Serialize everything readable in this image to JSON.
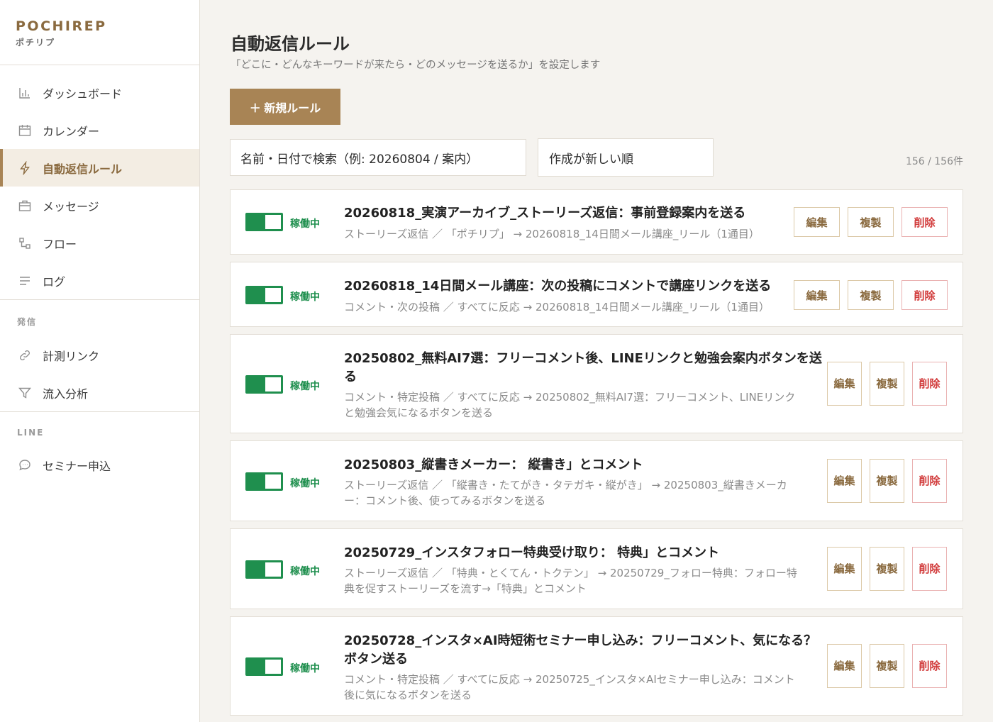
{
  "brand": {
    "name": "POCHIREP",
    "sub": "ポチリプ"
  },
  "sidebar": {
    "items": [
      {
        "label": "ダッシュボード",
        "icon": "bar-chart-icon"
      },
      {
        "label": "カレンダー",
        "icon": "calendar-icon"
      },
      {
        "label": "自動返信ルール",
        "icon": "lightning-icon",
        "active": true
      },
      {
        "label": "メッセージ",
        "icon": "briefcase-icon"
      },
      {
        "label": "フロー",
        "icon": "flow-icon"
      },
      {
        "label": "ログ",
        "icon": "list-icon"
      }
    ],
    "section_send": "発信",
    "send_items": [
      {
        "label": "計測リンク",
        "icon": "link-icon"
      },
      {
        "label": "流入分析",
        "icon": "filter-icon"
      }
    ],
    "section_line": "LINE",
    "line_items": [
      {
        "label": "セミナー申込",
        "icon": "chat-icon"
      }
    ]
  },
  "header": {
    "title": "自動返信ルール",
    "subtitle": "「どこに・どんなキーワードが来たら・どのメッセージを送るか」を設定します",
    "new_button": "＋ 新規ルール"
  },
  "filters": {
    "search_text": "名前・日付で検索（例: 20260804 / 案内）",
    "sort_value": "作成が新しい順",
    "count": "156 / 156件"
  },
  "rules": [
    {
      "status": "稼働中",
      "title": "20260818_実演アーカイブ_ストーリーズ返信：事前登録案内を送る",
      "desc": "ストーリーズ返信 ／ 「ポチリプ」 → 20260818_14日間メール講座_リール（1通目）",
      "edit": "編集",
      "copy": "複製",
      "delete": "削除"
    },
    {
      "status": "稼働中",
      "title": "20260818_14日間メール講座：次の投稿にコメントで講座リンクを送る",
      "desc": "コメント・次の投稿 ／ すべてに反応 → 20260818_14日間メール講座_リール（1通目）",
      "edit": "編集",
      "copy": "複製",
      "delete": "削除"
    },
    {
      "status": "稼働中",
      "title_lines": [
        "20250802_無料AI7選：フリーコメント後、LINEリンクと勉強会案内ボタンを送",
        "る"
      ],
      "desc_lines": [
        "コメント・特定投稿 ／ すべてに反応 → 20250802_無料AI7選：フリーコメント、LINEリンク",
        "と勉強会気になるボタンを送る"
      ],
      "edit": [
        "編",
        "集"
      ],
      "copy": [
        "複",
        "製"
      ],
      "delete": [
        "削",
        "除"
      ]
    },
    {
      "status": "稼働中",
      "title": "20250803_縦書きメーカー： 縦書き」とコメント",
      "desc_lines": [
        "ストーリーズ返信 ／ 「縦書き・たてがき・タテガキ・縦がき」 → 20250803_縦書きメーカ",
        "ー：コメント後、使ってみるボタンを送る"
      ],
      "edit": [
        "編",
        "集"
      ],
      "copy": [
        "複",
        "製"
      ],
      "delete": [
        "削",
        "除"
      ]
    },
    {
      "status": "稼働中",
      "title": "20250729_インスタフォロー特典受け取り： 特典」とコメント",
      "desc_lines": [
        "ストーリーズ返信 ／ 「特典・とくてん・トクテン」 → 20250729_フォロー特典：フォロー特",
        "典を促すストーリーズを流す→「特典」とコメント"
      ],
      "edit": [
        "編",
        "集"
      ],
      "copy": [
        "複",
        "製"
      ],
      "delete": [
        "削",
        "除"
      ]
    },
    {
      "status": "稼働中",
      "title_lines": [
        "20250728_インスタ×AI時短術セミナー申し込み：フリーコメント、気になる？",
        "ボタン送る"
      ],
      "desc_lines": [
        "コメント・特定投稿 ／ すべてに反応 → 20250725_インスタ×AIセミナー申し込み：コメント",
        "後に気になるボタンを送る"
      ],
      "edit": [
        "編",
        "集"
      ],
      "copy": [
        "複",
        "製"
      ],
      "delete": [
        "削",
        "除"
      ]
    }
  ],
  "colors": {
    "accent": "#a88455",
    "active_green": "#1f8f4e",
    "danger": "#d13a3a",
    "background": "#f5f3ef"
  }
}
